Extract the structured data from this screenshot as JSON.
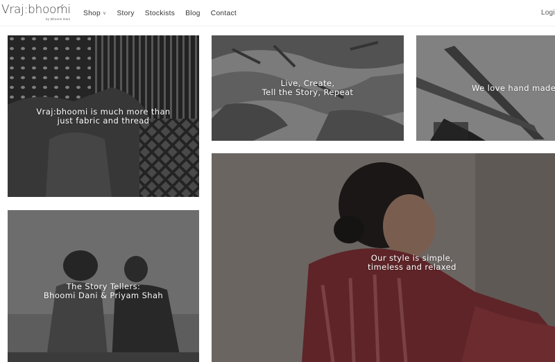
{
  "header": {
    "logo_text": "Vraj:bhoomi",
    "logo_sub": "by Bhoomi Dani",
    "nav": [
      {
        "label": "Shop",
        "has_dropdown": true
      },
      {
        "label": "Story"
      },
      {
        "label": "Stockists"
      },
      {
        "label": "Blog"
      },
      {
        "label": "Contact"
      }
    ],
    "login_label": "Login"
  },
  "tiles": [
    {
      "caption_lines": [
        "Vraj:bhoomi is much more than",
        "just fabric and thread"
      ]
    },
    {
      "caption_lines": [
        "Live, Create,",
        "Tell the Story, Repeat"
      ]
    },
    {
      "caption_lines": [
        "We love hand made"
      ]
    },
    {
      "caption_lines": [
        "The Story Tellers:",
        "Bhoomi Dani & Priyam Shah"
      ]
    },
    {
      "caption_lines": [
        "Our style is simple,",
        "timeless and relaxed"
      ]
    }
  ],
  "icons": {
    "dropdown": "chevron-down-icon",
    "logo_mark": "logo-mark-icon"
  },
  "colors": {
    "nav_text": "#333333",
    "caption_text": "#ffffff",
    "tint": "#4a4a4a",
    "accent_fabric": "#7a2a30"
  }
}
